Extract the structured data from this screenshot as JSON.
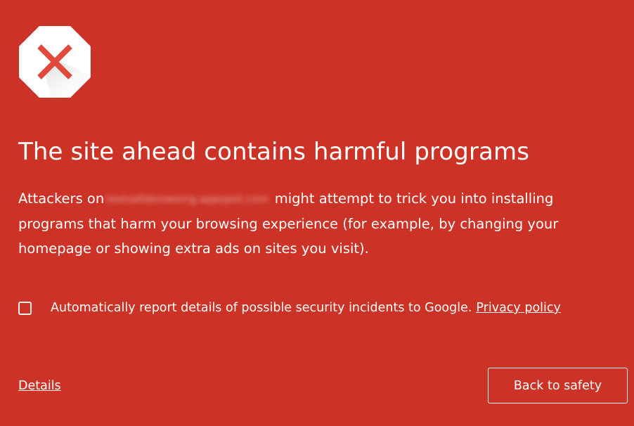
{
  "colors": {
    "background": "#cc3326",
    "icon_fill": "#ffffff",
    "icon_x": "#e04a3c",
    "text": "#ffffff"
  },
  "icon": {
    "name": "stop-x-icon"
  },
  "headline": "The site ahead contains harmful programs",
  "body": {
    "prefix": "Attackers on",
    "blurred_host": "testsafebrowsing.appspot.com",
    "suffix": "might attempt to trick you into installing programs that harm your browsing experience (for example, by changing your homepage or showing extra ads on sites you visit)."
  },
  "report": {
    "checked": false,
    "label": "Automatically report details of possible security incidents to Google.",
    "privacy_link": "Privacy policy"
  },
  "details_link": "Details",
  "back_button": "Back to safety"
}
